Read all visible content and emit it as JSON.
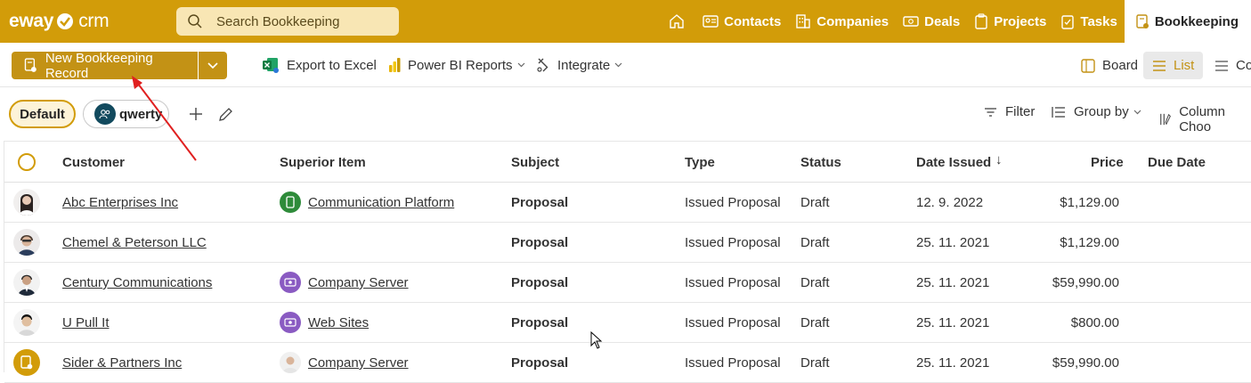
{
  "app": {
    "logo_left": "eway",
    "logo_right": "crm",
    "search_placeholder": "Search Bookkeeping"
  },
  "nav": {
    "items": [
      {
        "label": "Contacts",
        "icon": "contact-card-icon"
      },
      {
        "label": "Companies",
        "icon": "building-icon"
      },
      {
        "label": "Deals",
        "icon": "money-icon"
      },
      {
        "label": "Projects",
        "icon": "clipboard-icon"
      },
      {
        "label": "Tasks",
        "icon": "task-icon"
      },
      {
        "label": "Bookkeeping",
        "icon": "bookkeeping-icon",
        "active": true
      }
    ]
  },
  "toolbar": {
    "new_label": "New Bookkeeping Record",
    "export_label": "Export to Excel",
    "powerbi_label": "Power BI Reports",
    "integrate_label": "Integrate",
    "board_label": "Board",
    "list_label": "List",
    "co_label": "Co"
  },
  "filters": {
    "default_label": "Default",
    "user_label": "qwerty",
    "filter_label": "Filter",
    "groupby_label": "Group by",
    "columns_label": "Column Choo"
  },
  "grid": {
    "columns": [
      "Customer",
      "Superior Item",
      "Subject",
      "Type",
      "Status",
      "Date Issued",
      "Price",
      "Due Date"
    ],
    "sort_indicator": "↓",
    "rows": [
      {
        "customer": "Abc Enterprises Inc",
        "superior": "Communication Platform",
        "superior_icon": "phone-icon",
        "subject": "Proposal",
        "type": "Issued Proposal",
        "status": "Draft",
        "date": "12. 9. 2022",
        "price": "$1,129.00",
        "due": ""
      },
      {
        "customer": "Chemel & Peterson LLC",
        "superior": "",
        "superior_icon": "",
        "subject": "Proposal",
        "type": "Issued Proposal",
        "status": "Draft",
        "date": "25. 11. 2021",
        "price": "$1,129.00",
        "due": ""
      },
      {
        "customer": "Century Communications",
        "superior": "Company Server",
        "superior_icon": "project-icon",
        "subject": "Proposal",
        "type": "Issued Proposal",
        "status": "Draft",
        "date": "25. 11. 2021",
        "price": "$59,990.00",
        "due": ""
      },
      {
        "customer": "U Pull It",
        "superior": "Web Sites",
        "superior_icon": "project-icon",
        "subject": "Proposal",
        "type": "Issued Proposal",
        "status": "Draft",
        "date": "25. 11. 2021",
        "price": "$800.00",
        "due": ""
      },
      {
        "customer": "Sider & Partners Inc",
        "superior": "Company Server",
        "superior_icon": "person-icon",
        "subject": "Proposal",
        "type": "Issued Proposal",
        "status": "Draft",
        "date": "25. 11. 2021",
        "price": "$59,990.00",
        "due": ""
      }
    ]
  },
  "colors": {
    "brand": "#d29c09",
    "button": "#c39215",
    "search_bg": "#f8e6b4",
    "arrow": "#e02020"
  }
}
